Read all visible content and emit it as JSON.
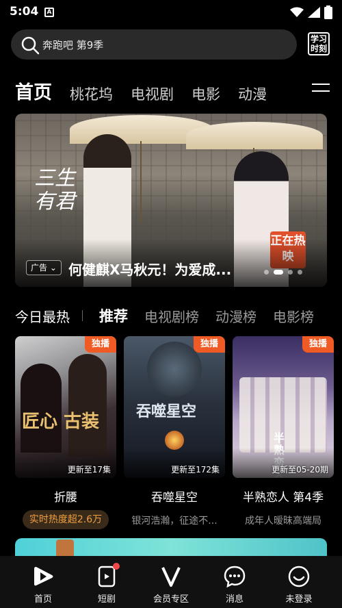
{
  "status": {
    "time": "5:04",
    "notification_icon": "a-app-icon"
  },
  "search": {
    "placeholder": "奔跑吧 第9季",
    "study_button": "学习时刻"
  },
  "categories": [
    {
      "label": "首页",
      "active": true
    },
    {
      "label": "桃花坞"
    },
    {
      "label": "电视剧"
    },
    {
      "label": "电影"
    },
    {
      "label": "动漫"
    }
  ],
  "banner": {
    "logo_text": "三生有君",
    "ad_label": "广告",
    "caption": "何健麒X马秋元！为爱成...",
    "tag": "正在热映",
    "page_count": 4,
    "current_page": 1
  },
  "ranks": [
    {
      "label": "今日最热"
    },
    {
      "label": "推荐",
      "active": true
    },
    {
      "label": "电视剧榜"
    },
    {
      "label": "动漫榜"
    },
    {
      "label": "电影榜"
    }
  ],
  "cards": [
    {
      "badge": "独播",
      "update": "更新至17集",
      "title": "折腰",
      "subtitle": "实时热度超2.6万",
      "poster_text": "匠心 古装"
    },
    {
      "badge": "独播",
      "update": "更新至172集",
      "title": "吞噬星空",
      "subtitle": "银河浩瀚，征途不...",
      "poster_text": "吞噬星空"
    },
    {
      "badge": "独播",
      "update": "更新至05-20期",
      "title": "半熟恋人 第4季",
      "subtitle": "成年人暧昧高端局",
      "poster_text": "半熟恋人"
    }
  ],
  "nav": [
    {
      "label": "首页",
      "icon": "play-icon",
      "active": true
    },
    {
      "label": "短剧",
      "icon": "short-video-icon",
      "badge_dot": true
    },
    {
      "label": "会员专区",
      "icon": "vip-v-icon"
    },
    {
      "label": "消息",
      "icon": "message-icon"
    },
    {
      "label": "未登录",
      "icon": "smile-face-icon"
    }
  ]
}
